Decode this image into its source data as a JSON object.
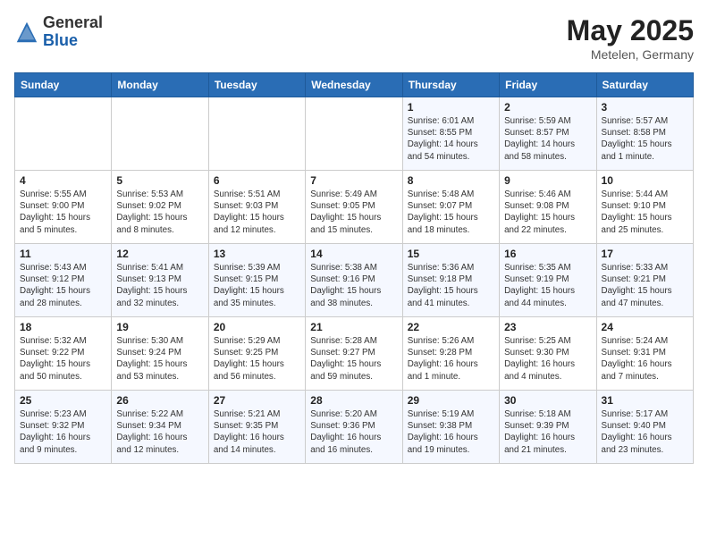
{
  "header": {
    "logo_general": "General",
    "logo_blue": "Blue",
    "month": "May 2025",
    "location": "Metelen, Germany"
  },
  "weekdays": [
    "Sunday",
    "Monday",
    "Tuesday",
    "Wednesday",
    "Thursday",
    "Friday",
    "Saturday"
  ],
  "weeks": [
    [
      {
        "day": "",
        "info": ""
      },
      {
        "day": "",
        "info": ""
      },
      {
        "day": "",
        "info": ""
      },
      {
        "day": "",
        "info": ""
      },
      {
        "day": "1",
        "info": "Sunrise: 6:01 AM\nSunset: 8:55 PM\nDaylight: 14 hours\nand 54 minutes."
      },
      {
        "day": "2",
        "info": "Sunrise: 5:59 AM\nSunset: 8:57 PM\nDaylight: 14 hours\nand 58 minutes."
      },
      {
        "day": "3",
        "info": "Sunrise: 5:57 AM\nSunset: 8:58 PM\nDaylight: 15 hours\nand 1 minute."
      }
    ],
    [
      {
        "day": "4",
        "info": "Sunrise: 5:55 AM\nSunset: 9:00 PM\nDaylight: 15 hours\nand 5 minutes."
      },
      {
        "day": "5",
        "info": "Sunrise: 5:53 AM\nSunset: 9:02 PM\nDaylight: 15 hours\nand 8 minutes."
      },
      {
        "day": "6",
        "info": "Sunrise: 5:51 AM\nSunset: 9:03 PM\nDaylight: 15 hours\nand 12 minutes."
      },
      {
        "day": "7",
        "info": "Sunrise: 5:49 AM\nSunset: 9:05 PM\nDaylight: 15 hours\nand 15 minutes."
      },
      {
        "day": "8",
        "info": "Sunrise: 5:48 AM\nSunset: 9:07 PM\nDaylight: 15 hours\nand 18 minutes."
      },
      {
        "day": "9",
        "info": "Sunrise: 5:46 AM\nSunset: 9:08 PM\nDaylight: 15 hours\nand 22 minutes."
      },
      {
        "day": "10",
        "info": "Sunrise: 5:44 AM\nSunset: 9:10 PM\nDaylight: 15 hours\nand 25 minutes."
      }
    ],
    [
      {
        "day": "11",
        "info": "Sunrise: 5:43 AM\nSunset: 9:12 PM\nDaylight: 15 hours\nand 28 minutes."
      },
      {
        "day": "12",
        "info": "Sunrise: 5:41 AM\nSunset: 9:13 PM\nDaylight: 15 hours\nand 32 minutes."
      },
      {
        "day": "13",
        "info": "Sunrise: 5:39 AM\nSunset: 9:15 PM\nDaylight: 15 hours\nand 35 minutes."
      },
      {
        "day": "14",
        "info": "Sunrise: 5:38 AM\nSunset: 9:16 PM\nDaylight: 15 hours\nand 38 minutes."
      },
      {
        "day": "15",
        "info": "Sunrise: 5:36 AM\nSunset: 9:18 PM\nDaylight: 15 hours\nand 41 minutes."
      },
      {
        "day": "16",
        "info": "Sunrise: 5:35 AM\nSunset: 9:19 PM\nDaylight: 15 hours\nand 44 minutes."
      },
      {
        "day": "17",
        "info": "Sunrise: 5:33 AM\nSunset: 9:21 PM\nDaylight: 15 hours\nand 47 minutes."
      }
    ],
    [
      {
        "day": "18",
        "info": "Sunrise: 5:32 AM\nSunset: 9:22 PM\nDaylight: 15 hours\nand 50 minutes."
      },
      {
        "day": "19",
        "info": "Sunrise: 5:30 AM\nSunset: 9:24 PM\nDaylight: 15 hours\nand 53 minutes."
      },
      {
        "day": "20",
        "info": "Sunrise: 5:29 AM\nSunset: 9:25 PM\nDaylight: 15 hours\nand 56 minutes."
      },
      {
        "day": "21",
        "info": "Sunrise: 5:28 AM\nSunset: 9:27 PM\nDaylight: 15 hours\nand 59 minutes."
      },
      {
        "day": "22",
        "info": "Sunrise: 5:26 AM\nSunset: 9:28 PM\nDaylight: 16 hours\nand 1 minute."
      },
      {
        "day": "23",
        "info": "Sunrise: 5:25 AM\nSunset: 9:30 PM\nDaylight: 16 hours\nand 4 minutes."
      },
      {
        "day": "24",
        "info": "Sunrise: 5:24 AM\nSunset: 9:31 PM\nDaylight: 16 hours\nand 7 minutes."
      }
    ],
    [
      {
        "day": "25",
        "info": "Sunrise: 5:23 AM\nSunset: 9:32 PM\nDaylight: 16 hours\nand 9 minutes."
      },
      {
        "day": "26",
        "info": "Sunrise: 5:22 AM\nSunset: 9:34 PM\nDaylight: 16 hours\nand 12 minutes."
      },
      {
        "day": "27",
        "info": "Sunrise: 5:21 AM\nSunset: 9:35 PM\nDaylight: 16 hours\nand 14 minutes."
      },
      {
        "day": "28",
        "info": "Sunrise: 5:20 AM\nSunset: 9:36 PM\nDaylight: 16 hours\nand 16 minutes."
      },
      {
        "day": "29",
        "info": "Sunrise: 5:19 AM\nSunset: 9:38 PM\nDaylight: 16 hours\nand 19 minutes."
      },
      {
        "day": "30",
        "info": "Sunrise: 5:18 AM\nSunset: 9:39 PM\nDaylight: 16 hours\nand 21 minutes."
      },
      {
        "day": "31",
        "info": "Sunrise: 5:17 AM\nSunset: 9:40 PM\nDaylight: 16 hours\nand 23 minutes."
      }
    ]
  ]
}
